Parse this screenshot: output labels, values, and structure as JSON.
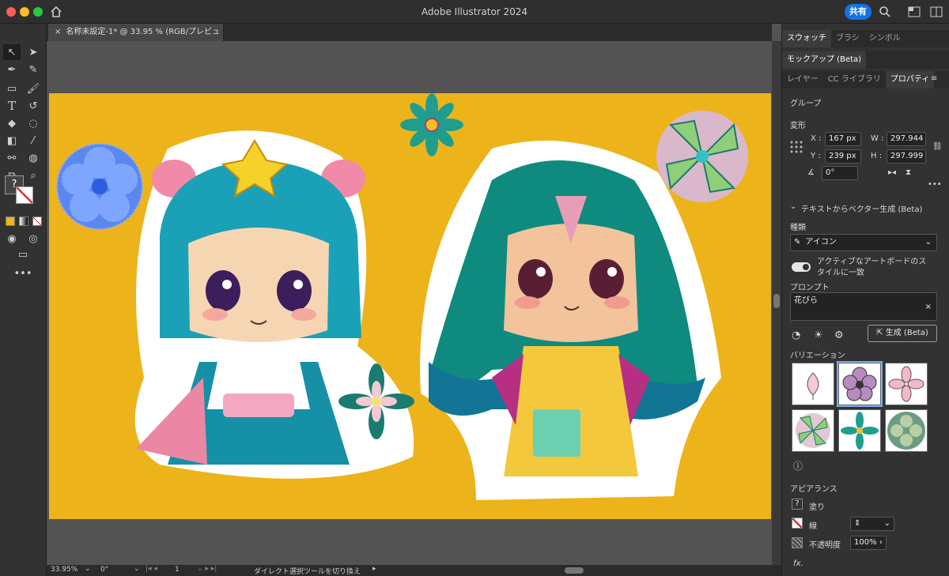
{
  "app": {
    "title": "Adobe Illustrator 2024",
    "share": "共有"
  },
  "document": {
    "tab": "名称未設定-1* @ 33.95 % (RGB/プレビュー)"
  },
  "status": {
    "zoom": "33.95%",
    "rotation": "0°",
    "artboard": "1",
    "tool_hint": "ダイレクト選択ツールを切り換え"
  },
  "panels": {
    "top_tabs": [
      "スウォッチ",
      "ブラシ",
      "シンボル"
    ],
    "mockup_tab": "モックアップ (Beta)",
    "tabs": [
      "レイヤー",
      "CC ライブラリ",
      "プロパティ"
    ],
    "group_label": "グループ",
    "transform": {
      "title": "変形",
      "x_label": "X :",
      "x": "167 px",
      "y_label": "Y :",
      "y": "239 px",
      "w_label": "W :",
      "w": "297.944",
      "h_label": "H :",
      "h": "297.999",
      "angle": "0°"
    },
    "t2v": {
      "title": "テキストからベクター生成 (Beta)",
      "kind_label": "種類",
      "kind": "アイコン",
      "toggle_label_1": "アクティブなアートボードのス",
      "toggle_label_2": "タイルに一致",
      "prompt_label": "プロンプト",
      "prompt": "花びら",
      "generate": "生成 (Beta)",
      "variations_label": "バリエーション"
    },
    "appearance": {
      "title": "アピアランス",
      "fill": "塗り",
      "stroke": "線",
      "opacity_label": "不透明度",
      "opacity": "100%",
      "fx": "fx."
    }
  },
  "colors": {
    "artboard": "#edb31b",
    "accent": "#1473e6"
  }
}
